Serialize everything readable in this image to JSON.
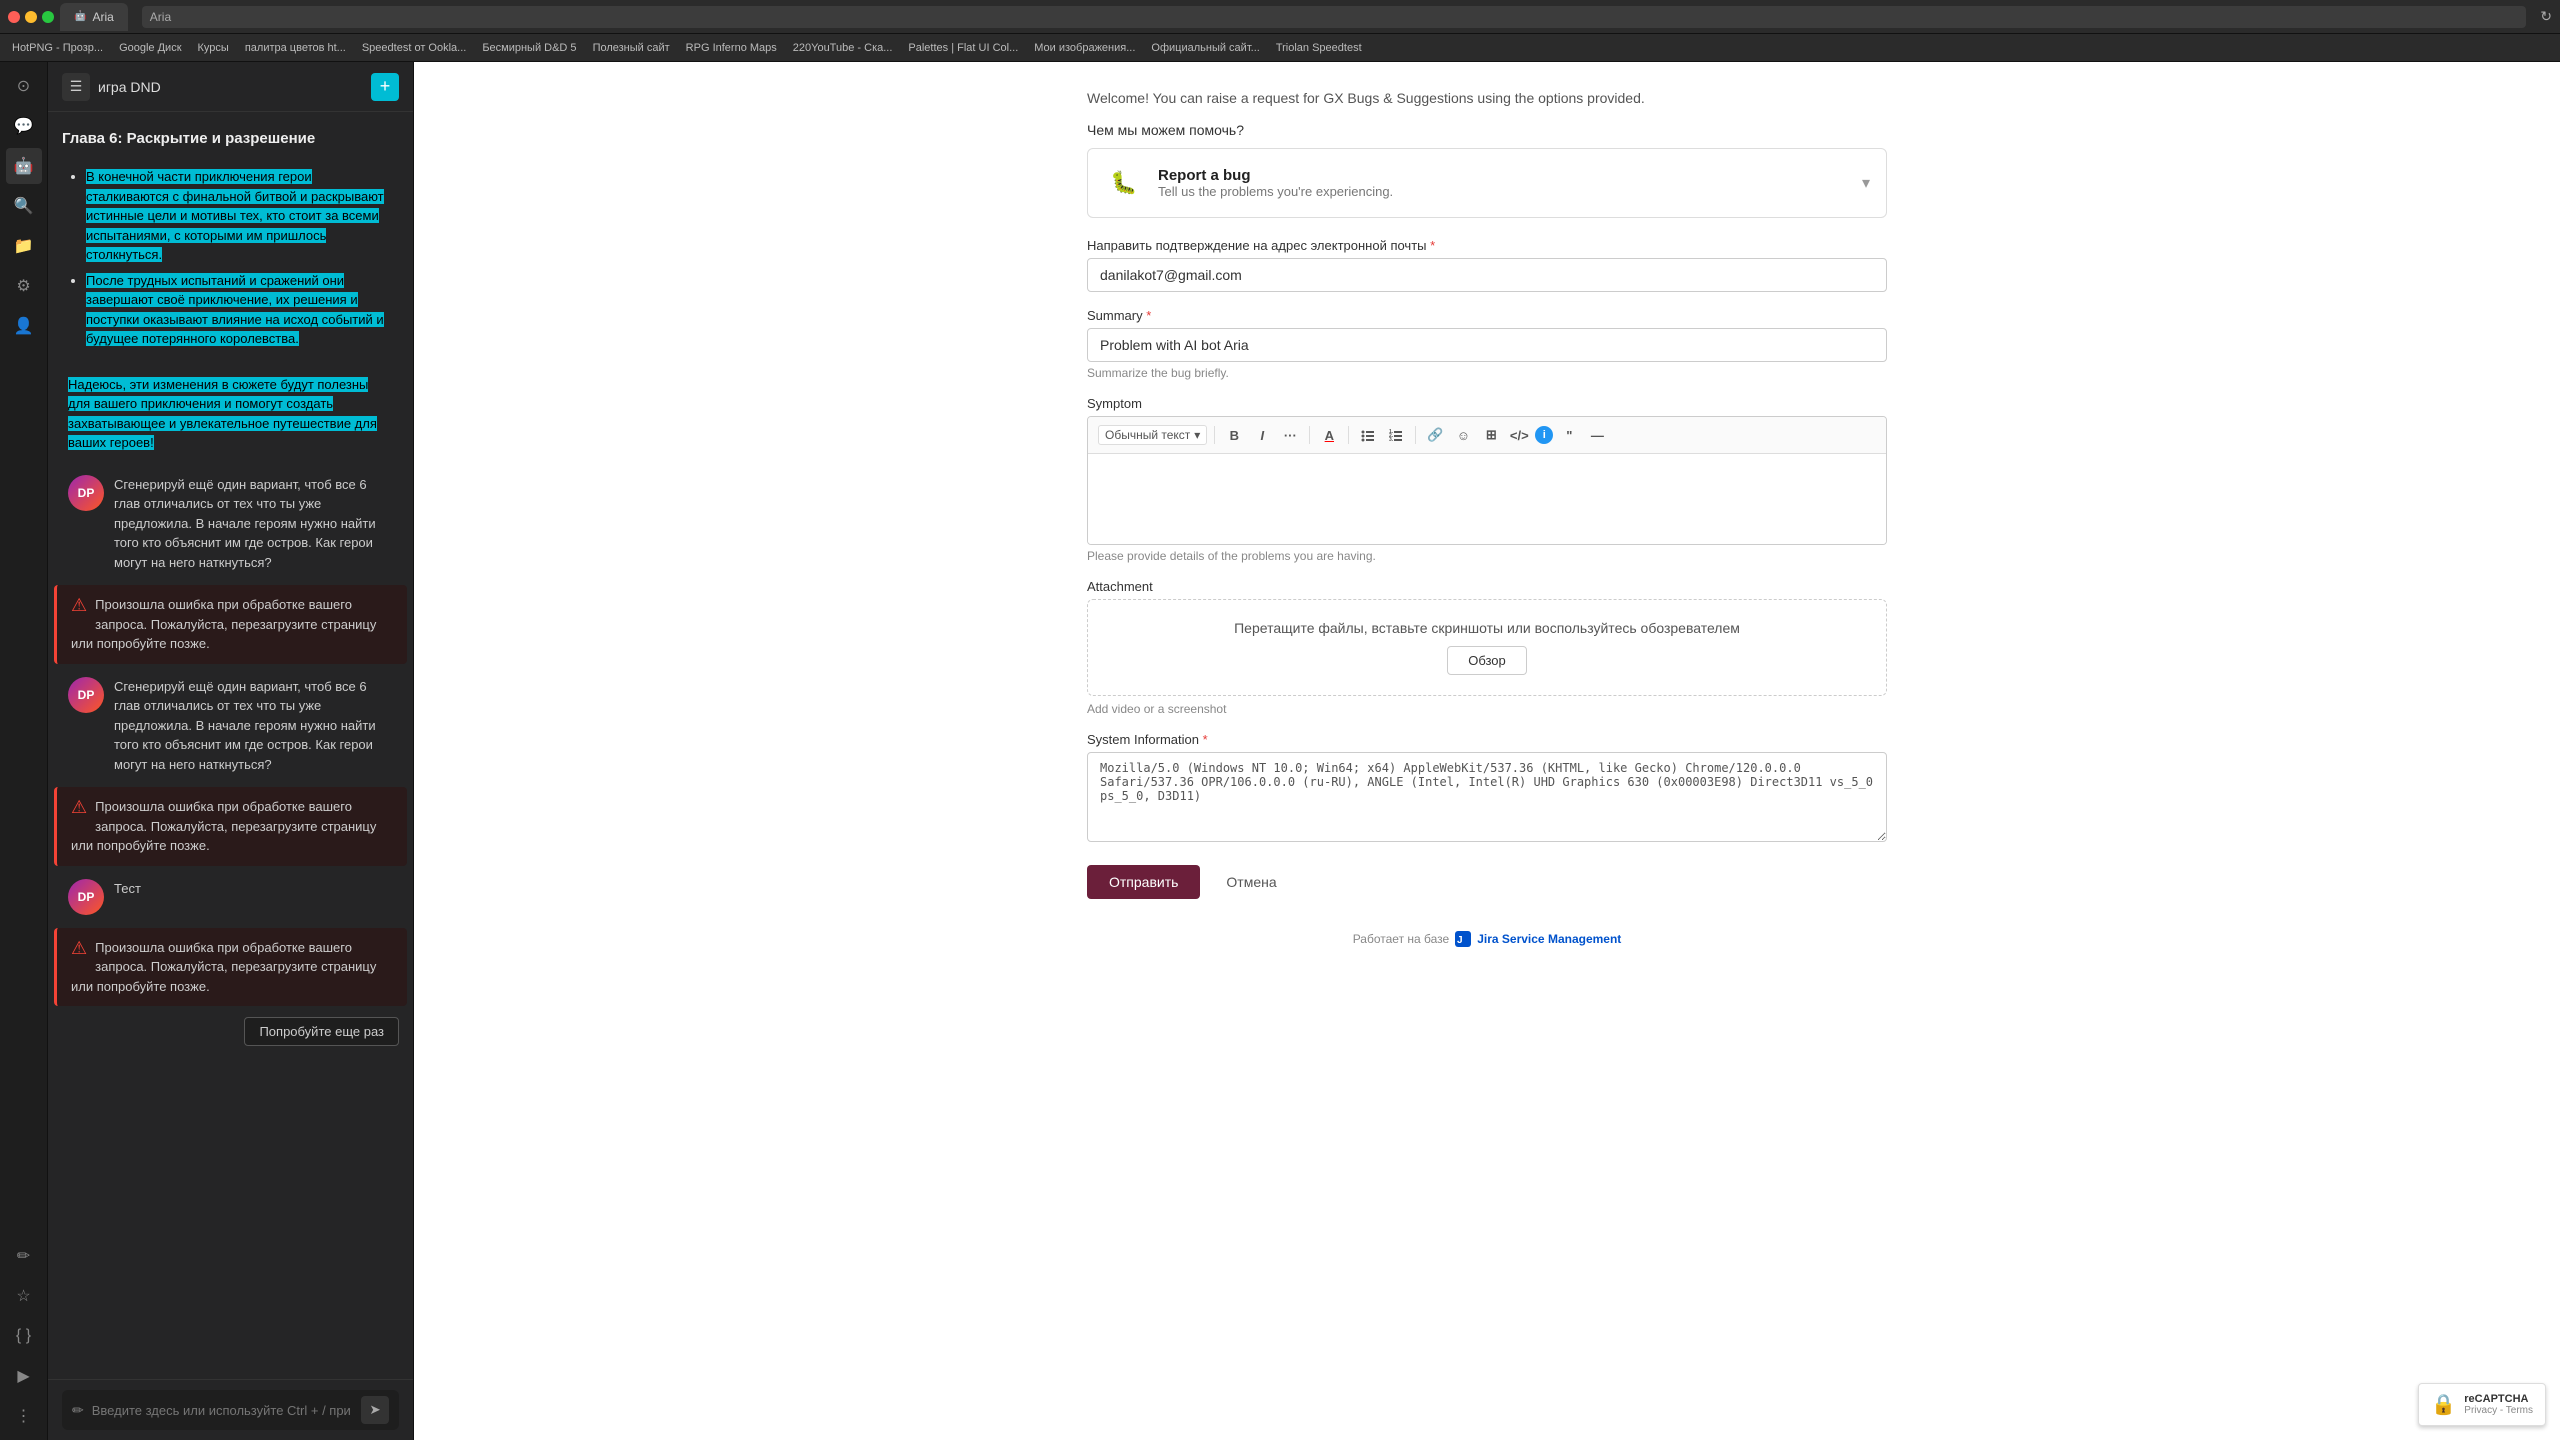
{
  "browser": {
    "tab_title": "Aria",
    "tab_favicon": "🤖",
    "address": "Aria",
    "reload_icon": "↻",
    "bookmarks": [
      "HotPNG - Прозр...",
      "Google Диск",
      "Курсы",
      "палитра цветов ht...",
      "Speedtest от Ookla...",
      "Бесмирный D&D 5",
      "Полезный сайт",
      "RPG Inferno Maps",
      "220YouTube - Ска...",
      "Palettes | Flat UI Col...",
      "Мои изображения...",
      "Официальный сайт...",
      "Triolan Speedtest"
    ]
  },
  "sidebar": {
    "title": "игра DND",
    "new_chat_icon": "+",
    "hamburger_icon": "☰",
    "chapter_heading": "Глава 6: Раскрытие и разрешение",
    "chat_content_1": {
      "bullet1": "В конечной части приключения герои сталкиваются с финальной битвой и раскрывают истинные цели и мотивы тех, кто стоит за всеми испытаниями, с которыми им пришлось столкнуться.",
      "bullet2": "После трудных испытаний и сражений они завершают своё приключение, их решения и поступки оказывают влияние на исход событий и будущее потерянного королевства."
    },
    "chat_content_2": "Надеюсь, эти изменения в сюжете будут полезны для вашего приключения и помогут создать захватывающее и увлекательное путешествие для ваших героев!",
    "message_items": [
      {
        "type": "user",
        "text": "Сгенерируй ещё один вариант, чтоб все 6 глав отличались от тех что ты уже предложила. В начале героям нужно найти того кто объяснит им где остров. Как герои могут на него наткнуться?"
      },
      {
        "type": "error",
        "text": "Произошла ошибка при обработке вашего запроса. Пожалуйста, перезагрузите страницу или попробуйте позже."
      },
      {
        "type": "user",
        "text": "Сгенерируй ещё один вариант, чтоб все 6 глав отличались от тех что ты уже предложила. В начале героям нужно найти того кто объяснит им где остров. Как герои могут на него наткнуться?"
      },
      {
        "type": "error",
        "text": "Произошла ошибка при обработке вашего запроса. Пожалуйста, перезагрузите страницу или попробуйте позже."
      },
      {
        "type": "user",
        "text": "Тест"
      },
      {
        "type": "error",
        "text": "Произошла ошибка при обработке вашего запроса. Пожалуйста, перезагрузите страницу или попробуйте позже."
      }
    ],
    "retry_btn": "Попробуйте еще раз",
    "input_placeholder": "Введите здесь или используйте Ctrl + / при просмотре"
  },
  "form": {
    "welcome_text": "Welcome! You can raise a request for GX Bugs & Suggestions using the options provided.",
    "help_label": "Чем мы можем помочь?",
    "report_bug": {
      "title": "Report a bug",
      "subtitle": "Tell us the problems you're experiencing.",
      "expand_icon": "▾"
    },
    "email_label": "Направить подтверждение на адрес электронной почты",
    "email_required": true,
    "email_value": "danilakot7@gmail.com",
    "summary_label": "Summary",
    "summary_required": true,
    "summary_value": "Problem with AI bot Aria",
    "summary_hint": "Summarize the bug briefly.",
    "symptom_label": "Symptom",
    "symptom_hint": "Please provide details of the problems you are having.",
    "toolbar": {
      "text_style": "Обычный текст",
      "bold": "B",
      "italic": "I",
      "more": "···",
      "text_color": "A",
      "bullet_list": "≡",
      "numbered_list": "≡",
      "link": "🔗",
      "emoji": "☺",
      "table": "⊞",
      "code": "</>",
      "info": "ℹ",
      "quote": "❝",
      "divider": "—"
    },
    "attachment_label": "Attachment",
    "attachment_dropzone_text": "Перетащите файлы, вставьте скриншоты или воспользуйтесь обозревателем",
    "attachment_browse_btn": "Обзор",
    "attachment_note": "Add video or a screenshot",
    "system_info_label": "System Information",
    "system_info_required": true,
    "system_info_value": "Mozilla/5.0 (Windows NT 10.0; Win64; x64) AppleWebKit/537.36 (KHTML, like Gecko) Chrome/120.0.0.0 Safari/537.36 OPR/106.0.0.0 (ru-RU), ANGLE (Intel, Intel(R) UHD Graphics 630 (0x00003E98) Direct3D11 vs_5_0 ps_5_0, D3D11)",
    "submit_btn": "Отправить",
    "cancel_btn": "Отмена",
    "powered_by_text": "Работает на базе",
    "powered_by_brand": "Jira Service Management"
  },
  "recaptcha": {
    "label": "reCAPTCHA"
  }
}
